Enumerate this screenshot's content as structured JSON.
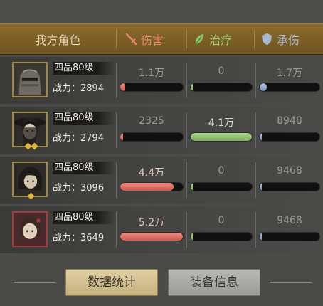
{
  "header": {
    "title": "我方角色",
    "columns": [
      {
        "label": "伤害",
        "icon": "sword-icon",
        "color": "#e88b6c"
      },
      {
        "label": "治疗",
        "icon": "leaf-icon",
        "color": "#a5d07a"
      },
      {
        "label": "承伤",
        "icon": "shield-icon",
        "color": "#aab8d4"
      }
    ]
  },
  "rows": [
    {
      "grade": "四品80级",
      "power": "战力：2894",
      "damage": "1.1万",
      "heal": "0",
      "taken": "1.7万",
      "damage_level": 0.08,
      "heal_level": 0.0,
      "taken_level": 0.12,
      "gems": 0
    },
    {
      "grade": "四品80级",
      "power": "战力：2794",
      "damage": "2325",
      "heal": "4.1万",
      "taken": "8948",
      "damage_level": 0.0,
      "heal_level": 1.0,
      "taken_level": 0.03,
      "gems": 2
    },
    {
      "grade": "四品80级",
      "power": "战力：3096",
      "damage": "4.4万",
      "heal": "0",
      "taken": "9468",
      "damage_level": 0.85,
      "heal_level": 0.0,
      "taken_level": 0.03,
      "gems": 1
    },
    {
      "grade": "四品80级",
      "power": "战力：3649",
      "damage": "5.2万",
      "heal": "0",
      "taken": "9468",
      "damage_level": 1.0,
      "heal_level": 0.0,
      "taken_level": 0.03,
      "gems": 0
    }
  ],
  "footer": {
    "stats_button": "数据统计",
    "equip_button": "装备信息"
  }
}
